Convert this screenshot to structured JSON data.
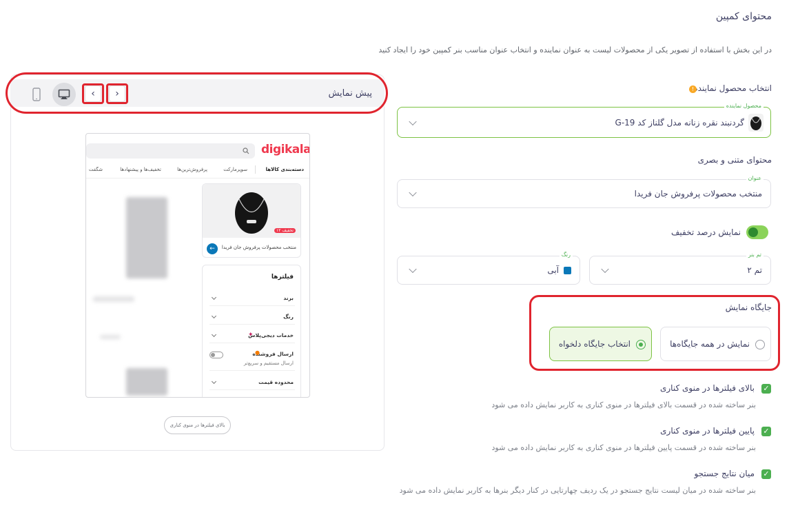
{
  "section": {
    "title": "محتوای کمپین",
    "description": "در این بخش با استفاده از تصویر یکی از محصولات لیست به عنوان نماینده و انتخاب عنوان مناسب بنر کمپین خود را ایجاد کنید"
  },
  "product": {
    "heading": "انتخاب محصول نماینده",
    "info_icon": "!",
    "legend": "محصول نماینده",
    "value": "گردنبند نقره زنانه مدل گلناز کد G-19"
  },
  "content": {
    "heading": "محتوای متنی و بصری",
    "title_legend": "عنوان",
    "title_value": "منتخب محصولات پرفروش جان فریدا"
  },
  "discount": {
    "label": "نمایش درصد تخفیف",
    "enabled": true
  },
  "theme": {
    "legend": "تم بنر",
    "value": "تم ۲"
  },
  "color": {
    "legend": "رنگ",
    "value": "آبی",
    "swatch": "#0a78b8"
  },
  "placement": {
    "heading": "جایگاه نمایش",
    "option_all": "نمایش در همه جایگاه‌ها",
    "option_custom": "انتخاب جایگاه دلخواه",
    "selected": "custom"
  },
  "positions": [
    {
      "title": "بالای فیلترها در منوی کناری",
      "desc": "بنر ساخته شده در قسمت بالای فیلترها در منوی کناری به کاربر نمایش داده می شود",
      "checked": true
    },
    {
      "title": "پایین فیلترها در منوی کناری",
      "desc": "بنر ساخته شده در قسمت پایین فیلترها در منوی کناری به کاربر نمایش داده می شود",
      "checked": true
    },
    {
      "title": "میان نتایج جستجو",
      "desc": "بنر ساخته شده در میان لیست نتایج جستجو در یک ردیف چهارتایی در کنار دیگر بنرها به کاربر نمایش داده می شود",
      "checked": true
    }
  ],
  "check_mark": "✓",
  "preview": {
    "title": "پیش نمایش",
    "prev_glyph": "‹",
    "next_glyph": "›",
    "caption": "بالای فیلترها در منوی کناری"
  },
  "mock": {
    "logo": "digikala",
    "nav": {
      "categories": "دسته‌بندی کالاها",
      "supermarket": "سوپرمارکت",
      "bestsellers": "پرفروش‌ترین‌ها",
      "offers": "تخفیف‌ها و پیشنهادها",
      "amazing": "شگفت"
    },
    "badge": "۱۲ تخفیف",
    "banner_title": "منتخب محصولات پرفروش جان فریدا",
    "filters_title": "فیلترها",
    "filters": [
      "برند",
      "رنگ"
    ],
    "plus_service": "خدمات دیجی‌پلاس",
    "seller_ship": "ارسال فروشنده",
    "seller_ship_desc": "ارسال مستقیم و سریع‌تر",
    "price_range": "محدوده قیمت"
  }
}
